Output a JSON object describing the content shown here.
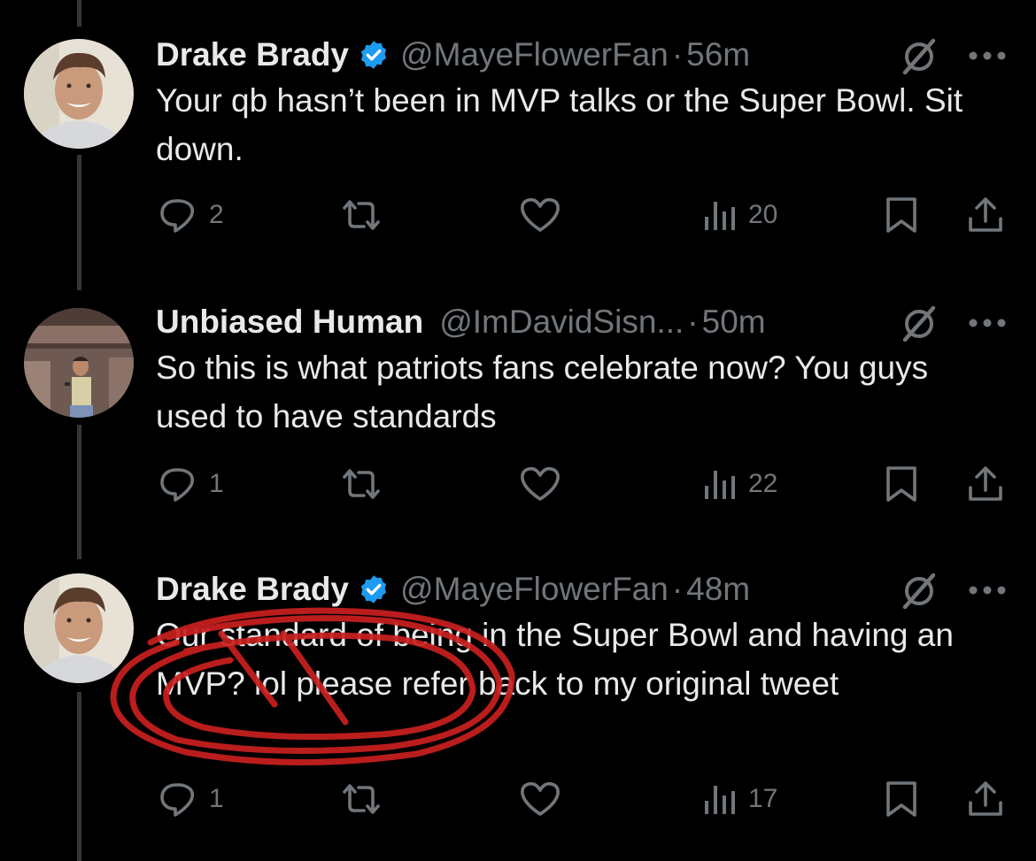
{
  "colors": {
    "background": "#000000",
    "text": "#e7e9ea",
    "muted": "#71767b",
    "verified": "#1d9bf0",
    "annotation": "#c8201f"
  },
  "tweets": [
    {
      "name": "Drake Brady",
      "verified": true,
      "handle": "@MayeFlowerFan",
      "dot": "·",
      "time": "56m",
      "text": "Your qb hasn’t been in MVP talks or the Super Bowl. Sit down.",
      "replies": "2",
      "retweets": "",
      "likes": "",
      "views": "20",
      "icons": [
        "grok-icon",
        "more-icon",
        "reply-icon",
        "retweet-icon",
        "like-icon",
        "views-icon",
        "bookmark-icon",
        "share-icon"
      ]
    },
    {
      "name": "Unbiased Human",
      "verified": false,
      "handle": "@ImDavidSisn...",
      "dot": "·",
      "time": "50m",
      "text": "So this is what patriots fans celebrate now? You guys used to have standards",
      "replies": "1",
      "retweets": "",
      "likes": "",
      "views": "22",
      "icons": [
        "grok-icon",
        "more-icon",
        "reply-icon",
        "retweet-icon",
        "like-icon",
        "views-icon",
        "bookmark-icon",
        "share-icon"
      ]
    },
    {
      "name": "Drake Brady",
      "verified": true,
      "handle": "@MayeFlowerFan",
      "dot": "·",
      "time": "48m",
      "text": "Our standard of being in the Super Bowl and having an MVP? lol please refer back to my original tweet",
      "replies": "1",
      "retweets": "",
      "likes": "",
      "views": "17",
      "icons": [
        "grok-icon",
        "more-icon",
        "reply-icon",
        "retweet-icon",
        "like-icon",
        "views-icon",
        "bookmark-icon",
        "share-icon"
      ]
    }
  ]
}
